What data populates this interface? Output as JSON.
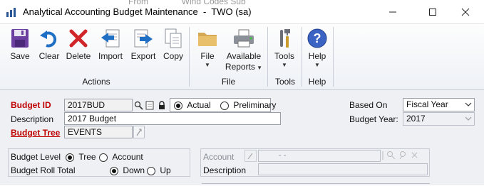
{
  "background_text": "From              Wind Codes Sub",
  "window": {
    "title": "Analytical Accounting Budget Maintenance  -  TWO (sa)",
    "controls": [
      "minimize",
      "maximize",
      "close"
    ]
  },
  "toolbar": {
    "save": "Save",
    "clear": "Clear",
    "delete": "Delete",
    "import": "Import",
    "export": "Export",
    "copy": "Copy",
    "file": "File",
    "available_reports": "Available Reports",
    "tools": "Tools",
    "help": "Help",
    "groups": {
      "actions": "Actions",
      "file": "File",
      "tools": "Tools",
      "help": "Help"
    }
  },
  "form": {
    "budget_id_label": "Budget ID",
    "budget_id_value": "2017BUD",
    "actual_label": "Actual",
    "preliminary_label": "Preliminary",
    "budget_type_selected": "Actual",
    "description_label": "Description",
    "description_value": "2017 Budget",
    "budget_tree_label": "Budget Tree",
    "budget_tree_value": "EVENTS",
    "based_on_label": "Based On",
    "based_on_value": "Fiscal Year",
    "budget_year_label": "Budget Year:",
    "budget_year_value": "2017",
    "budget_level_label": "Budget Level",
    "tree_label": "Tree",
    "account_option_label": "Account",
    "budget_level_selected": "Tree",
    "roll_total_label": "Budget Roll Total",
    "down_label": "Down",
    "up_label": "Up",
    "roll_total_selected": "Down",
    "account_label": "Account",
    "account_mask": "-          -",
    "account_description_label": "Description"
  },
  "colors": {
    "accent_red": "#c00000",
    "ribbon_bg": "#eef1f6",
    "form_bg": "#eef0f4"
  }
}
